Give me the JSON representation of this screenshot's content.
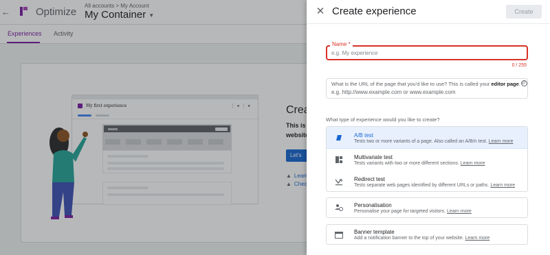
{
  "app": {
    "product": "Optimize",
    "breadcrumb": "All accounts > My Account",
    "container": "My Container",
    "tabs": [
      {
        "label": "Experiences"
      },
      {
        "label": "Activity"
      }
    ]
  },
  "background": {
    "mock_title": "My first experience",
    "hero_heading": "Crea",
    "hero_text_1": "This is",
    "hero_text_2": "website",
    "hero_button": "Let's",
    "link_1": "Learn",
    "link_2": "Chec"
  },
  "panel": {
    "title": "Create experience",
    "create_label": "Create",
    "name_label": "Name *",
    "name_placeholder": "e.g. My experience",
    "name_counter": "0 / 255",
    "url_label_pre": "What is the URL of the page that you'd like to use? This is called your ",
    "url_label_bold": "editor page",
    "url_label_post": ". *",
    "url_placeholder": "e.g. http://www.example.com or www.example.com",
    "type_question": "What type of experience would you like to create?",
    "options": [
      {
        "title": "A/B test",
        "desc": "Tests two or more variants of a page. Also called an A/B/n test.",
        "link": "Learn more",
        "icon": "ab-test-icon",
        "selected": true
      },
      {
        "title": "Multivariate test",
        "desc": "Tests variants with two or more different sections.",
        "link": "Learn more",
        "icon": "multivariate-icon"
      },
      {
        "title": "Redirect test",
        "desc": "Tests separate web pages identified by different URLs or paths.",
        "link": "Learn more",
        "icon": "redirect-icon"
      },
      {
        "title": "Personalisation",
        "desc": "Personalise your page for targeted visitors.",
        "link": "Learn more",
        "icon": "personalisation-icon"
      },
      {
        "title": "Banner template",
        "desc": "Add a notification banner to the top of your website.",
        "link": "Learn more",
        "icon": "banner-icon"
      }
    ]
  },
  "colors": {
    "accent": "#1967d2",
    "error": "#d93025",
    "brand": "#7b1fa2"
  }
}
